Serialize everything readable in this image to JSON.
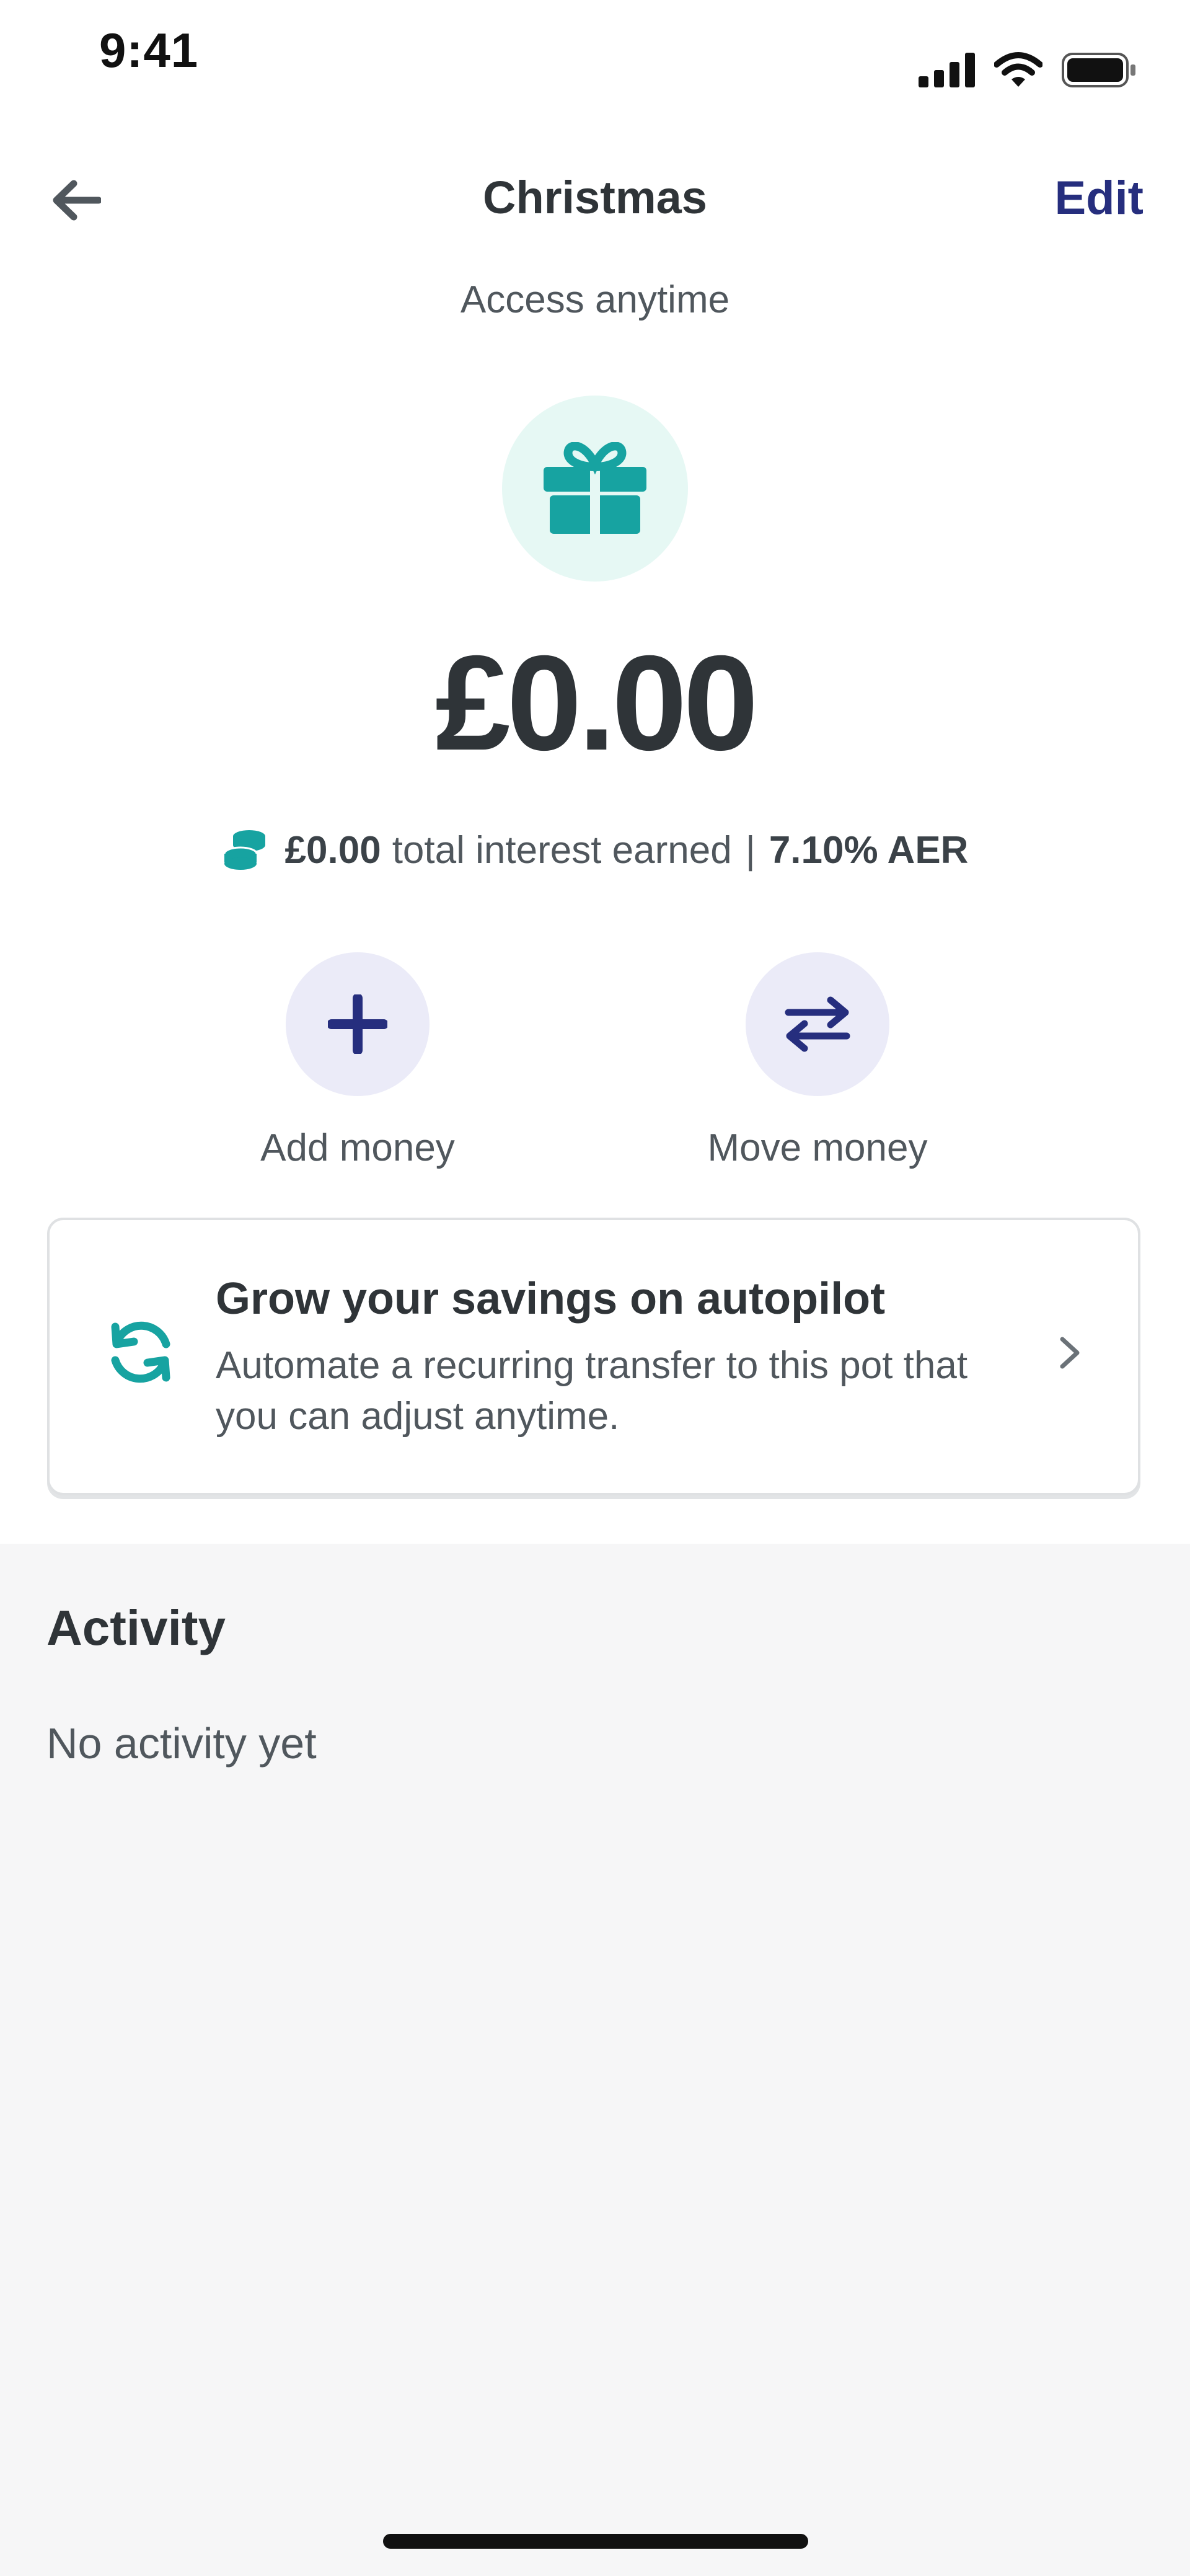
{
  "status_bar": {
    "time": "9:41"
  },
  "header": {
    "title": "Christmas",
    "edit_label": "Edit",
    "subtitle": "Access anytime"
  },
  "pot": {
    "icon": "gift-icon",
    "balance": "£0.00",
    "interest_amount": "£0.00",
    "interest_text": "total interest earned",
    "separator": "|",
    "rate": "7.10% AER"
  },
  "actions": {
    "add_label": "Add money",
    "move_label": "Move money"
  },
  "autopilot_card": {
    "title": "Grow your savings on autopilot",
    "description": "Automate a recurring transfer to this pot that you can adjust anytime."
  },
  "activity": {
    "title": "Activity",
    "empty_text": "No activity yet"
  },
  "colors": {
    "accent_navy": "#262e7e",
    "accent_teal": "#17a3a1",
    "icon_bg_mint": "#e6f8f4",
    "icon_bg_lavender": "#ebebf8"
  }
}
